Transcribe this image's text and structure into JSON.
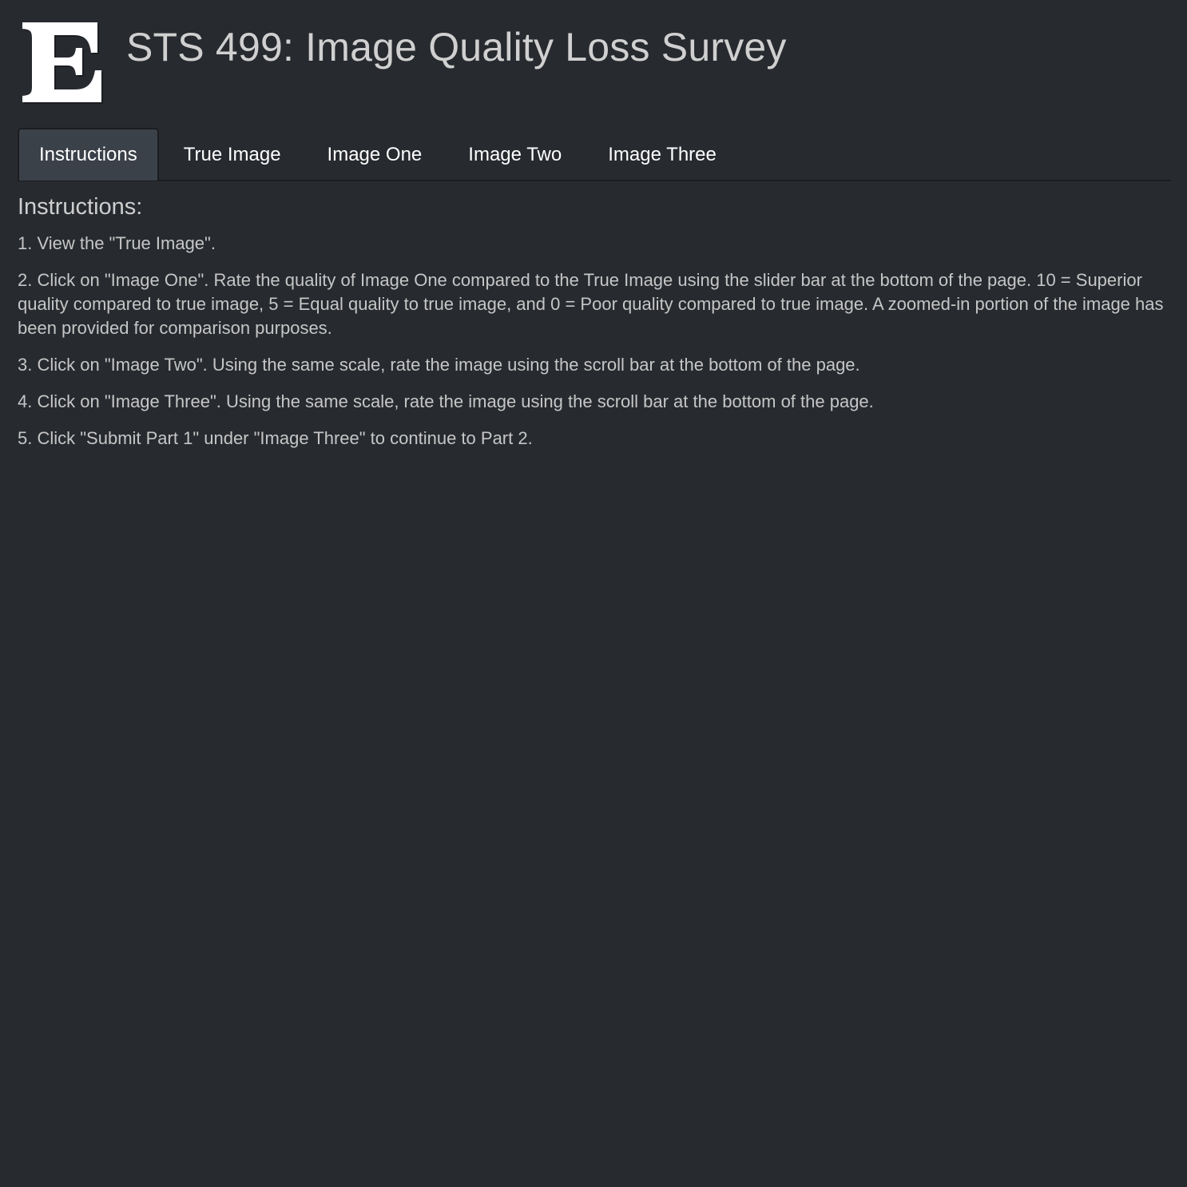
{
  "header": {
    "logo_letter": "E",
    "title": "STS 499: Image Quality Loss Survey"
  },
  "tabs": [
    {
      "label": "Instructions",
      "active": true
    },
    {
      "label": "True Image",
      "active": false
    },
    {
      "label": "Image One",
      "active": false
    },
    {
      "label": "Image Two",
      "active": false
    },
    {
      "label": "Image Three",
      "active": false
    }
  ],
  "instructions": {
    "heading": "Instructions:",
    "steps": [
      "1. View the \"True Image\".",
      "2. Click on \"Image One\". Rate the quality of Image One compared to the True Image using the slider bar at the bottom of the page. 10 = Superior quality compared to true image, 5 = Equal quality to true image, and 0 = Poor quality compared to true image. A zoomed-in portion of the image has been provided for comparison purposes.",
      "3. Click on \"Image Two\". Using the same scale, rate the image using the scroll bar at the bottom of the page.",
      "4. Click on \"Image Three\". Using the same scale, rate the image using the scroll bar at the bottom of the page.",
      "5. Click \"Submit Part 1\" under \"Image Three\" to continue to Part 2."
    ]
  },
  "colors": {
    "background": "#272a2f",
    "active_tab": "#3b4149",
    "text": "#c6c6c6"
  }
}
